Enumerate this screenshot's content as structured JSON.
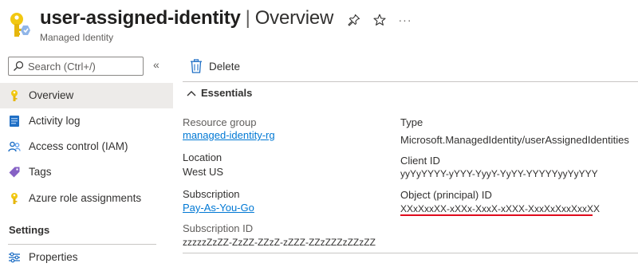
{
  "header": {
    "resource_name": "user-assigned-identity",
    "separator": "|",
    "section": "Overview",
    "subtitle": "Managed Identity",
    "more_label": "···"
  },
  "search": {
    "placeholder": "Search (Ctrl+/)",
    "value": ""
  },
  "sidebar": {
    "collapse_label": "«",
    "items": [
      {
        "label": "Overview",
        "icon": "key-icon",
        "selected": true
      },
      {
        "label": "Activity log",
        "icon": "activity-log-icon"
      },
      {
        "label": "Access control (IAM)",
        "icon": "people-icon"
      },
      {
        "label": "Tags",
        "icon": "tag-icon"
      },
      {
        "label": "Azure role assignments",
        "icon": "key-icon"
      }
    ],
    "settings_header": "Settings",
    "settings_items": [
      {
        "label": "Properties",
        "icon": "sliders-icon"
      }
    ]
  },
  "toolbar": {
    "delete_label": "Delete"
  },
  "essentials": {
    "header": "Essentials",
    "left": [
      {
        "label": "Resource group",
        "value": "managed-identity-rg",
        "is_link": true
      },
      {
        "label": "Location",
        "value": "West US",
        "is_link": false
      },
      {
        "label": "Subscription",
        "value": "Pay-As-You-Go",
        "is_link": true
      },
      {
        "label": "Subscription ID",
        "value": "zzzzzZzZZ-ZzZZ-ZZzZ-zZZZ-ZZzZZZzZZzZZ",
        "is_link": false
      }
    ],
    "right": [
      {
        "label": "Type",
        "value": "Microsoft.ManagedIdentity/userAssignedIdentities"
      },
      {
        "label": "Client ID",
        "value": "yyYyYYYY-yYYY-YyyY-YyYY-YYYYYyyYyYYY"
      },
      {
        "label": "Object (principal) ID",
        "value": "XXxXxxXX-xXXx-XxxX-xXXX-XxxXxXxxXxxXX",
        "highlighted": true
      }
    ]
  },
  "colors": {
    "accent": "#0078d4",
    "selected_bg": "#edebe9",
    "key_icon": "#f2c811",
    "highlight_underline": "#e00b1c"
  }
}
